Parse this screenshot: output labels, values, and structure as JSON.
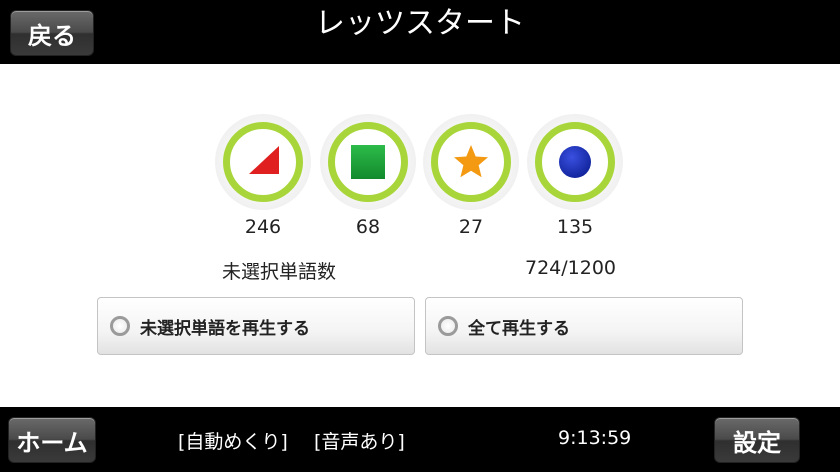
{
  "header": {
    "back_label": "戻る",
    "title": "レッツスタート"
  },
  "badges": [
    {
      "shape": "triangle-icon",
      "color": "#e02020",
      "count": "246"
    },
    {
      "shape": "square-icon",
      "color": "#1aa03a",
      "count": "68"
    },
    {
      "shape": "star-icon",
      "color": "#f39a12",
      "count": "27"
    },
    {
      "shape": "circle-icon",
      "color": "#1a2fb5",
      "count": "135"
    }
  ],
  "stats": {
    "unselected_label": "未選択単語数",
    "progress": "724/1200"
  },
  "options": {
    "play_unselected": "未選択単語を再生する",
    "play_all": "全て再生する"
  },
  "footer": {
    "home_label": "ホーム",
    "auto_flip": "[自動めくり]",
    "sound": "[音声あり]",
    "time": "9:13:59",
    "settings_label": "設定"
  },
  "colors": {
    "ring": "#a8d63a",
    "bar": "#000000"
  }
}
